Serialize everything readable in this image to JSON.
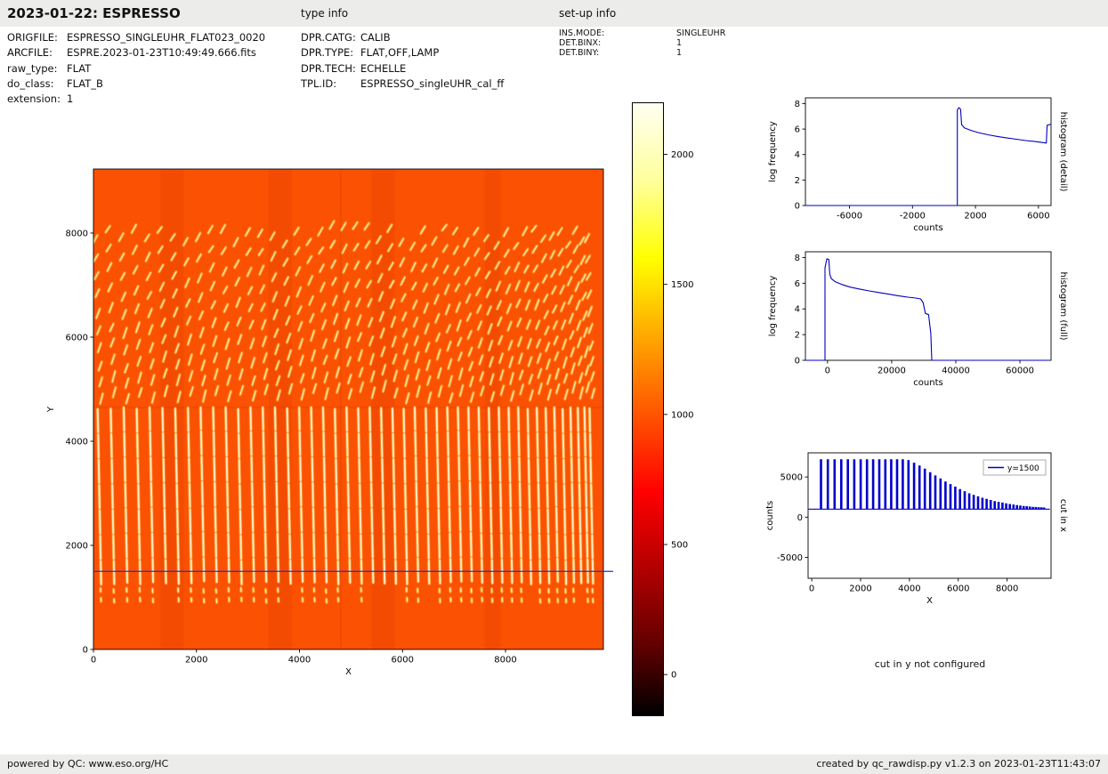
{
  "header": {
    "title": "2023-01-22: ESPRESSO",
    "type_info_label": "type info",
    "setup_info_label": "set-up info"
  },
  "file_info": {
    "rows": [
      {
        "label": "ORIGFILE:",
        "value": "ESPRESSO_SINGLEUHR_FLAT023_0020"
      },
      {
        "label": "ARCFILE:",
        "value": "ESPRE.2023-01-23T10:49:49.666.fits"
      },
      {
        "label": "raw_type:",
        "value": "FLAT"
      },
      {
        "label": "do_class:",
        "value": "FLAT_B"
      },
      {
        "label": "extension:",
        "value": "1"
      }
    ]
  },
  "type_info": {
    "rows": [
      {
        "label": "DPR.CATG:",
        "value": "CALIB"
      },
      {
        "label": "DPR.TYPE:",
        "value": "FLAT,OFF,LAMP"
      },
      {
        "label": "DPR.TECH:",
        "value": "ECHELLE"
      },
      {
        "label": "TPL.ID:",
        "value": "ESPRESSO_singleUHR_cal_ff"
      }
    ]
  },
  "setup_info": {
    "rows": [
      {
        "label": "INS.MODE:",
        "value": "SINGLEUHR"
      },
      {
        "label": "DET.BINX:",
        "value": "1"
      },
      {
        "label": "DET.BINY:",
        "value": "1"
      }
    ]
  },
  "cut_in_y_text": "cut in y not configured",
  "footer": {
    "left": "powered by QC: www.eso.org/HC",
    "right": "created by qc_rawdisp.py v1.2.3 on 2023-01-23T11:43:07"
  },
  "chart_data": [
    {
      "id": "raw_image",
      "type": "heatmap",
      "title": "",
      "xlabel": "X",
      "ylabel": "Y",
      "xlim": [
        0,
        9900
      ],
      "ylim": [
        0,
        9230
      ],
      "xticks": [
        0,
        2000,
        4000,
        6000,
        8000
      ],
      "yticks": [
        0,
        2000,
        4000,
        6000,
        8000
      ],
      "cut_line_y": 1500,
      "cut_line_color": "#2b2bcc",
      "background_counts": 1000,
      "colors": {
        "background": "#fb5103",
        "trace_glow": "#ffa514",
        "trace_core": "#fffce1"
      },
      "orders": {
        "n": 46,
        "x_start": 150,
        "x_end": 9700,
        "crowding": 1.2,
        "y_bottom": 900,
        "y_dash_low": 1250,
        "y_solid_top": 4650,
        "y_top": 8150
      },
      "dark_bands": [
        [
          1300,
          1750
        ],
        [
          3400,
          3850
        ],
        [
          5400,
          5850
        ],
        [
          7600,
          7900
        ]
      ]
    },
    {
      "id": "colorbar",
      "type": "colorbar",
      "colormap": "hot",
      "vmin": -160,
      "vmax": 2200,
      "ticks": [
        0,
        500,
        1000,
        1500,
        2000
      ]
    },
    {
      "id": "histogram_detail",
      "type": "line",
      "right_label": "histogram (detail)",
      "xlabel": "counts",
      "ylabel": "log frequency",
      "xlim": [
        -8800,
        6800
      ],
      "ylim": [
        0,
        8.45
      ],
      "xticks": [
        -6000,
        -2000,
        2000,
        6000
      ],
      "yticks": [
        0,
        2,
        4,
        6,
        8
      ],
      "series": [
        {
          "name": "histogram",
          "color": "#0000bb",
          "x": [
            -8800,
            850,
            850,
            950,
            1060,
            1120,
            1300,
            1700,
            2200,
            2800,
            3400,
            4000,
            4600,
            5200,
            5800,
            6200,
            6500,
            6550,
            6800
          ],
          "y": [
            0,
            0,
            7.5,
            7.68,
            7.55,
            6.35,
            6.1,
            5.9,
            5.72,
            5.55,
            5.42,
            5.3,
            5.2,
            5.1,
            5.02,
            4.95,
            4.9,
            6.3,
            6.38
          ]
        }
      ]
    },
    {
      "id": "histogram_full",
      "type": "line",
      "right_label": "histogram (full)",
      "xlabel": "counts",
      "ylabel": "log frequency",
      "xlim": [
        -6900,
        69700
      ],
      "ylim": [
        0,
        8.45
      ],
      "xticks": [
        0,
        20000,
        40000,
        60000
      ],
      "yticks": [
        0,
        2,
        4,
        6,
        8
      ],
      "series": [
        {
          "name": "histogram",
          "color": "#0000bb",
          "x": [
            -6900,
            -800,
            -800,
            -200,
            400,
            700,
            1200,
            2500,
            4500,
            7000,
            10000,
            13000,
            16000,
            19000,
            22000,
            25000,
            27500,
            29000,
            29800,
            30500,
            31500,
            32200,
            32500,
            69000
          ],
          "y": [
            0,
            0,
            7.2,
            7.9,
            7.85,
            6.7,
            6.35,
            6.1,
            5.9,
            5.7,
            5.55,
            5.4,
            5.28,
            5.15,
            5.03,
            4.92,
            4.85,
            4.78,
            4.5,
            3.65,
            3.55,
            2.1,
            0,
            0
          ]
        }
      ]
    },
    {
      "id": "cut_in_x",
      "type": "line",
      "right_label": "cut in x",
      "xlabel": "X",
      "ylabel": "counts",
      "legend_label": "y=1500",
      "line_color": "#0000cc",
      "xlim": [
        -150,
        9800
      ],
      "ylim": [
        -7600,
        8000
      ],
      "xticks": [
        0,
        2000,
        4000,
        6000,
        8000
      ],
      "yticks": [
        -5000,
        0,
        5000
      ],
      "baseline": 1000,
      "comb": {
        "n": 48,
        "x_start": 380,
        "spacing_start": 280,
        "spacing_end": 105
      },
      "envelope_x": [
        0,
        3900,
        4500,
        5000,
        5500,
        6000,
        6500,
        7000,
        7500,
        8000,
        8500,
        9000,
        9500
      ],
      "envelope_y": [
        7200,
        7200,
        6300,
        5300,
        4400,
        3600,
        2900,
        2400,
        2000,
        1700,
        1450,
        1300,
        1200
      ]
    }
  ]
}
